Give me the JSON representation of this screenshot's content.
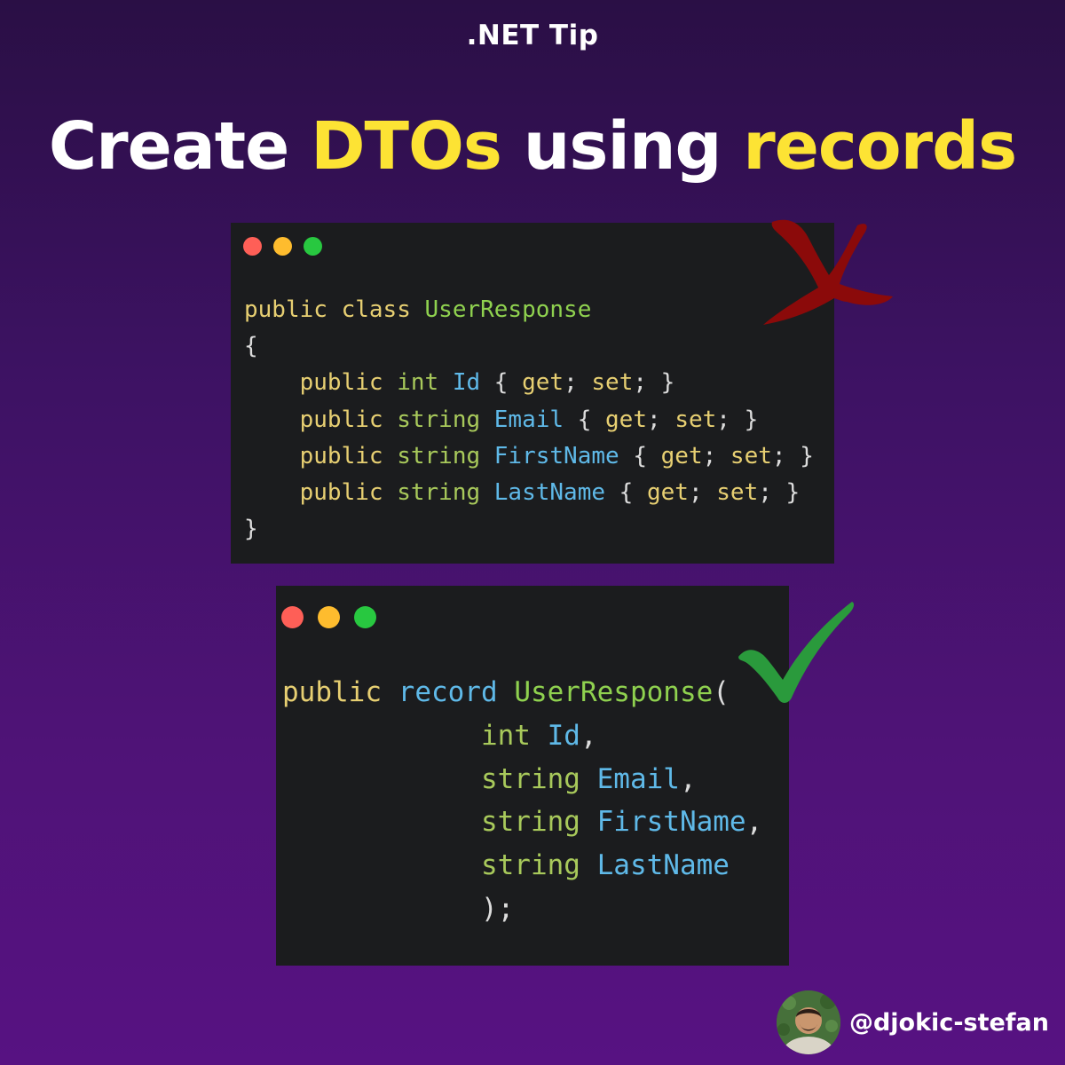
{
  "header": {
    "tip_label": ".NET Tip",
    "headline": {
      "part1": "Create ",
      "highlight1": "DTOs",
      "part2": " using ",
      "highlight2": "records"
    },
    "highlight_color": "#fde334"
  },
  "class_example": {
    "verdict_icon": "cross-icon",
    "verdict_color": "#8b0a0a",
    "lines": [
      "public class UserResponse",
      "{",
      "    public int Id { get; set; }",
      "    public string Email { get; set; }",
      "    public string FirstName { get; set; }",
      "    public string LastName { get; set; }",
      "}"
    ]
  },
  "record_example": {
    "verdict_icon": "checkmark-icon",
    "verdict_color": "#2a9a3c",
    "lines": [
      "public record UserResponse(",
      "            int Id,",
      "            string Email,",
      "            string FirstName,",
      "            string LastName",
      "            );"
    ]
  },
  "window_dot_colors": [
    "#fe5f57",
    "#febc2e",
    "#28c840"
  ],
  "author": {
    "handle": "@djokic-stefan",
    "avatar_icon": "avatar-photo"
  }
}
